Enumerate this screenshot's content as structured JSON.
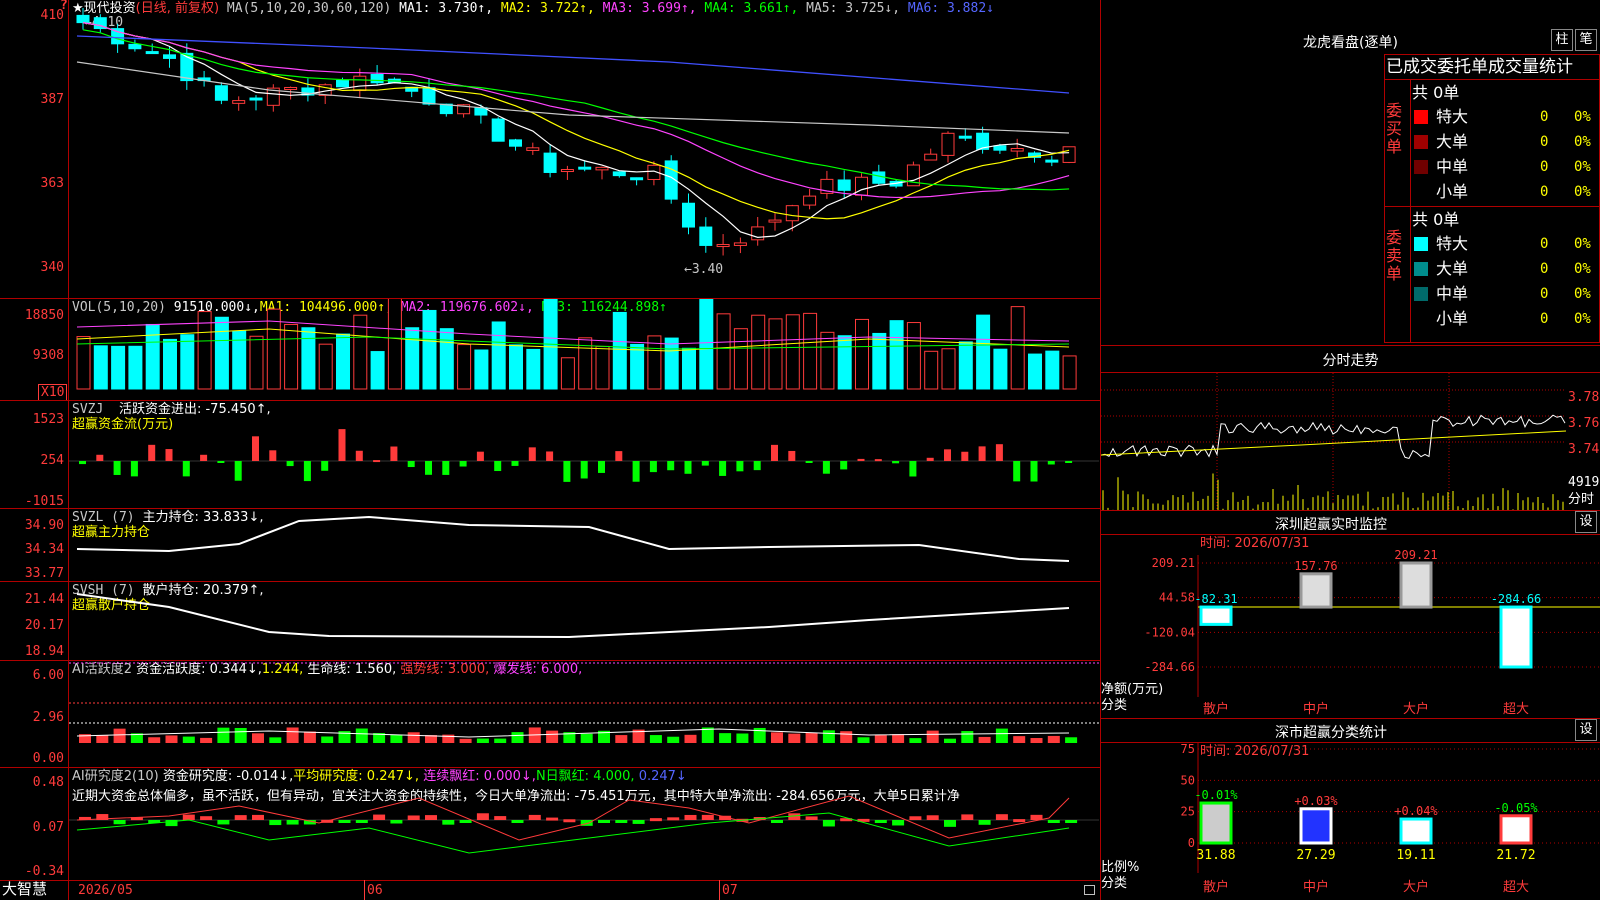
{
  "colors": {
    "up": "#ff3b3b",
    "down": "#00ffff",
    "grid": "#b00000",
    "ma1": "#ffffff",
    "ma2": "#ffff00",
    "ma3": "#ff44ff",
    "ma4": "#00ff00",
    "ma5": "#c8c8c8",
    "ma6": "#4050ff"
  },
  "main_chart": {
    "stock": "现代投资",
    "mode": "(日线, 前复权)",
    "ma_label": "MA(5,10,20,30,60,120)",
    "ma1": "MA1: 3.730↑,",
    "ma2": "MA2: 3.722↑,",
    "ma3": "MA3: 3.699↑,",
    "ma4": "MA4: 3.661↑,",
    "ma5": "MA5: 3.725↓,",
    "ma6": "MA6: 3.882↓",
    "high_marker": "←4.10",
    "low_marker": "←3.40",
    "y_labels": [
      "410",
      "387",
      "363",
      "340"
    ],
    "top_marker": "?"
  },
  "vol_panel": {
    "label": "VOL(5,10,20)",
    "vol": "91510.000↓,",
    "ma1": "MA1: 104496.000↑,",
    "ma2": "MA2: 119676.602↓,",
    "ma3": "MA3: 116244.898↑",
    "y_labels": [
      "18850",
      "9308"
    ],
    "unit": "X10"
  },
  "svzj_panel": {
    "label": "SVZJ",
    "text": "活跃资金进出: -75.450↑,",
    "sub": "超赢资金流(万元)",
    "y_labels": [
      "1523",
      "254",
      "-1015"
    ]
  },
  "svzl_panel": {
    "label": "SVZL (7)",
    "text": "主力持仓: 33.833↓,",
    "sub": "超赢主力持仓",
    "y_labels": [
      "34.90",
      "34.34",
      "33.77"
    ]
  },
  "svsh_panel": {
    "label": "SVSH (7)",
    "text": "散户持仓: 20.379↑,",
    "sub": "超赢散户持仓",
    "y_labels": [
      "21.44",
      "20.17",
      "18.94"
    ]
  },
  "ai_panel": {
    "label": "AI活跃度2",
    "t1": "资金活跃度: 0.344↓,",
    "t2": "1.244,",
    "t3": "生命线: 1.560,",
    "t4": "强势线: 3.000,",
    "t5": "爆发线: 6.000,",
    "y_labels": [
      "6.00",
      "2.96",
      "0.00"
    ]
  },
  "ai2_panel": {
    "label": "AI研究度2(10)",
    "t1": "资金研究度: -0.014↓,",
    "t2": "平均研究度: 0.247↓,",
    "t3": "连续飘红: 0.000↓,",
    "t4": "N日飘红: 4.000,",
    "t5": "0.247↓",
    "comment": "近期大资金总体偏多，虽不活跃，但有异动，宜关注大资金的持续性，今日大单净流出: -75.451万元，其中特大单净流出: -284.656万元，大单5日累计净",
    "y_labels": [
      "0.48",
      "0.07",
      "-0.34"
    ]
  },
  "bottom_bar": {
    "brand": "大智慧",
    "dates": [
      "2026/05",
      "06",
      "07"
    ]
  },
  "lhb": {
    "title": "龙虎看盘(逐单)",
    "btn1": "柱",
    "btn2": "笔",
    "header": "已成交委托单成交量统计",
    "buy": {
      "side": "委买单",
      "total": "共 0单",
      "rows": [
        {
          "name": "特大",
          "count": "0",
          "pct": "0%",
          "color": "#ff0000"
        },
        {
          "name": "大单",
          "count": "0",
          "pct": "0%",
          "color": "#a00000"
        },
        {
          "name": "中单",
          "count": "0",
          "pct": "0%",
          "color": "#700000"
        },
        {
          "name": "小单",
          "count": "0",
          "pct": "0%",
          "color": "#000000"
        }
      ]
    },
    "sell": {
      "side": "委卖单",
      "total": "共 0单",
      "rows": [
        {
          "name": "特大",
          "count": "0",
          "pct": "0%",
          "color": "#00ffff"
        },
        {
          "name": "大单",
          "count": "0",
          "pct": "0%",
          "color": "#008c8c"
        },
        {
          "name": "中单",
          "count": "0",
          "pct": "0%",
          "color": "#006a6a"
        },
        {
          "name": "小单",
          "count": "0",
          "pct": "0%",
          "color": "#000000"
        }
      ]
    }
  },
  "intraday": {
    "title": "分时走势",
    "y_labels": [
      "3.780",
      "3.760",
      "3.740"
    ],
    "vol_top": "4919",
    "vol_unit": "分时"
  },
  "sz_monitor": {
    "title": "深圳超赢实时监控",
    "btn": "设",
    "time": "时间: 2026/07/31",
    "y_labels": [
      "209.21",
      "44.58",
      "-120.04",
      "-284.66"
    ],
    "unit1": "净额(万元)",
    "unit2": "分类",
    "bars": [
      {
        "cat": "散户",
        "value": -82.31,
        "label": "-82.31"
      },
      {
        "cat": "中户",
        "value": 157.76,
        "label": "157.76"
      },
      {
        "cat": "大户",
        "value": 209.21,
        "label": "209.21"
      },
      {
        "cat": "超大",
        "value": -284.66,
        "label": "-284.66"
      }
    ]
  },
  "sz_class": {
    "title": "深市超赢分类统计",
    "btn": "设",
    "time": "时间: 2026/07/31",
    "y_labels": [
      "75",
      "50",
      "25",
      "0"
    ],
    "unit1": "比例%",
    "unit2": "分类",
    "bars": [
      {
        "cat": "散户",
        "value": 31.88,
        "label": "31.88",
        "chg": "-0.01%"
      },
      {
        "cat": "中户",
        "value": 27.29,
        "label": "27.29",
        "chg": "+0.03%"
      },
      {
        "cat": "大户",
        "value": 19.11,
        "label": "19.11",
        "chg": "+0.04%"
      },
      {
        "cat": "超大",
        "value": 21.72,
        "label": "21.72",
        "chg": "-0.05%"
      }
    ]
  }
}
